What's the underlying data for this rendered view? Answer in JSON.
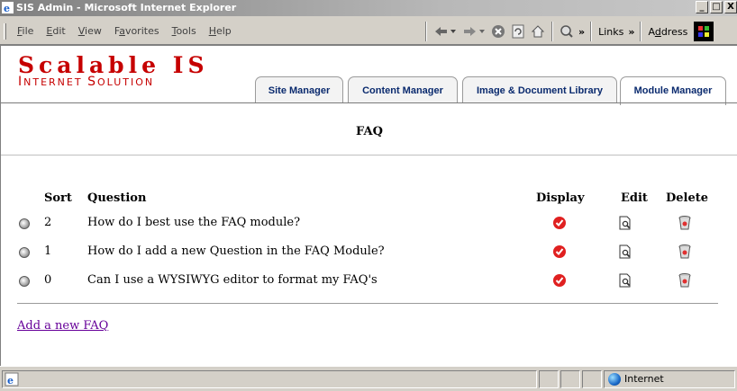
{
  "window": {
    "title": "SIS Admin - Microsoft Internet Explorer",
    "controls": [
      "_",
      "□",
      "X"
    ]
  },
  "menu": [
    {
      "label": "File",
      "ul": "F",
      "rest": "ile"
    },
    {
      "label": "Edit",
      "ul": "E",
      "rest": "dit"
    },
    {
      "label": "View",
      "ul": "V",
      "rest": "iew"
    },
    {
      "label": "Favorites",
      "ul": "a",
      "pre": "F",
      "rest": "vorites"
    },
    {
      "label": "Tools",
      "ul": "T",
      "rest": "ools"
    },
    {
      "label": "Help",
      "ul": "H",
      "rest": "elp"
    }
  ],
  "toolbar": {
    "links_label": "Links",
    "address_label": "Address",
    "chevron": "»"
  },
  "logo": {
    "line1": "Scalable IS",
    "line2_a": "I",
    "line2_b": "NTERNET ",
    "line2_c": "S",
    "line2_d": "OLUTION"
  },
  "tabs": [
    {
      "label": "Site Manager",
      "active": false
    },
    {
      "label": "Content Manager",
      "active": false
    },
    {
      "label": "Image & Document Library",
      "active": false
    },
    {
      "label": "Module Manager",
      "active": true
    }
  ],
  "page": {
    "title": "FAQ",
    "headers": {
      "sort": "Sort",
      "question": "Question",
      "display": "Display",
      "edit": "Edit",
      "delete": "Delete"
    },
    "rows": [
      {
        "sort": "2",
        "question": "How do I best use the FAQ module?"
      },
      {
        "sort": "1",
        "question": "How do I add a new Question in the FAQ Module?"
      },
      {
        "sort": "0",
        "question": "Can I use a WYSIWYG editor to format my FAQ's"
      }
    ],
    "add_link": "Add a new FAQ"
  },
  "status": {
    "zone": "Internet"
  },
  "colors": {
    "brand": "#c60000",
    "tab_text": "#0a2a6e",
    "visited_link": "#660099",
    "display_check": "#e02020"
  }
}
